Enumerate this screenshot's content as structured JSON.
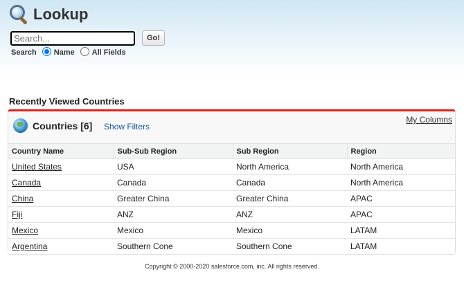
{
  "header": {
    "title": "Lookup",
    "icon": "magnifier-icon"
  },
  "search": {
    "placeholder": "Search...",
    "value": "",
    "go_label": "Go!"
  },
  "scope": {
    "label": "Search",
    "options": [
      "Name",
      "All Fields"
    ],
    "selected": "Name"
  },
  "section_title": "Recently Viewed Countries",
  "panel": {
    "icon": "globe-icon",
    "title": "Countries [6]",
    "show_filters": "Show Filters",
    "my_columns": "My Columns"
  },
  "table": {
    "columns": [
      "Country Name",
      "Sub-Sub Region",
      "Sub Region",
      "Region"
    ],
    "rows": [
      [
        "United States",
        "USA",
        "North America",
        "North America"
      ],
      [
        "Canada",
        "Canada",
        "Canada",
        "North America"
      ],
      [
        "China",
        "Greater China",
        "Greater China",
        "APAC"
      ],
      [
        "Fiji",
        "ANZ",
        "ANZ",
        "APAC"
      ],
      [
        "Mexico",
        "Mexico",
        "Mexico",
        "LATAM"
      ],
      [
        "Argentina",
        "Southern Cone",
        "Southern Cone",
        "LATAM"
      ]
    ]
  },
  "footer": "Copyright © 2000-2020 salesforce.com, inc. All rights reserved.",
  "colors": {
    "accent": "#e2231a",
    "link": "#15569d"
  }
}
